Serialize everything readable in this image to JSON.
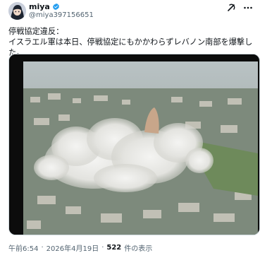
{
  "author": {
    "name": "miya",
    "handle": "@miya397156651",
    "verified_icon": "verified-badge-icon"
  },
  "actions": {
    "grok_icon": "grok-icon",
    "more_icon": "more-icon"
  },
  "tweet": {
    "text": "停戦協定違反：\nイスラエル軍は本日、停戦協定にもかかわらずレバノン南部を爆撃した。"
  },
  "media": {
    "kind": "video",
    "subject": "aerial-smoke-explosion"
  },
  "meta": {
    "time": "午前6:54",
    "date": "2026年4月19日",
    "views_count": "522",
    "views_label": "件の表示",
    "sep": "·"
  },
  "colors": {
    "verified": "#1d9bf0",
    "muted": "#536471"
  }
}
